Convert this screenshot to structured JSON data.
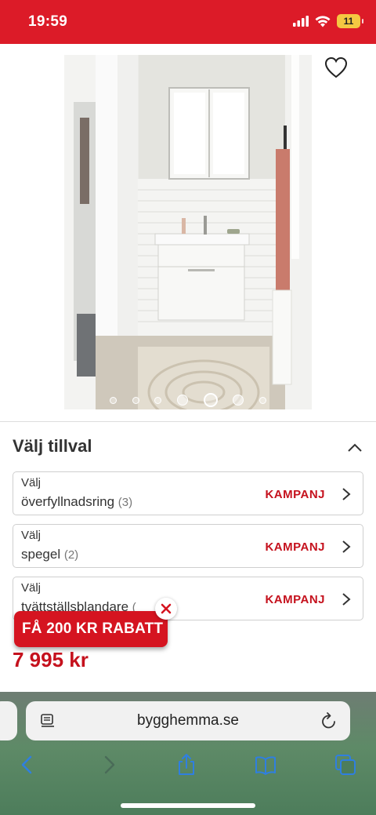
{
  "status_bar": {
    "time": "19:59",
    "battery": "11",
    "icons": [
      "cellular-icon",
      "wifi-icon",
      "battery-icon"
    ],
    "color": "#dc1b28"
  },
  "product": {
    "image_alt": "Badrumsmöbel",
    "wishlist_icon": "heart-outline-icon",
    "carousel": {
      "count": 7,
      "active_index": 4
    }
  },
  "options": {
    "title": "Välj tillval",
    "items": [
      {
        "sub": "Välj",
        "main": "överfyllnadsring",
        "count": "(3)",
        "promo": "KAMPANJ"
      },
      {
        "sub": "Välj",
        "main": "spegel",
        "count": "(2)",
        "promo": "KAMPANJ"
      },
      {
        "sub": "Välj",
        "main": "tvättställsblandare",
        "count": "(",
        "promo": "KAMPANJ"
      }
    ]
  },
  "promo_badge": {
    "label": "FÅ 200 KR RABATT",
    "color": "#d51420"
  },
  "price": {
    "value": "7 995 kr",
    "color": "#c5111d"
  },
  "browser": {
    "url": "bygghemma.se",
    "icons": [
      "reader-icon",
      "reload-icon",
      "back-icon",
      "forward-icon",
      "share-icon",
      "bookmarks-icon",
      "tabs-icon"
    ]
  }
}
